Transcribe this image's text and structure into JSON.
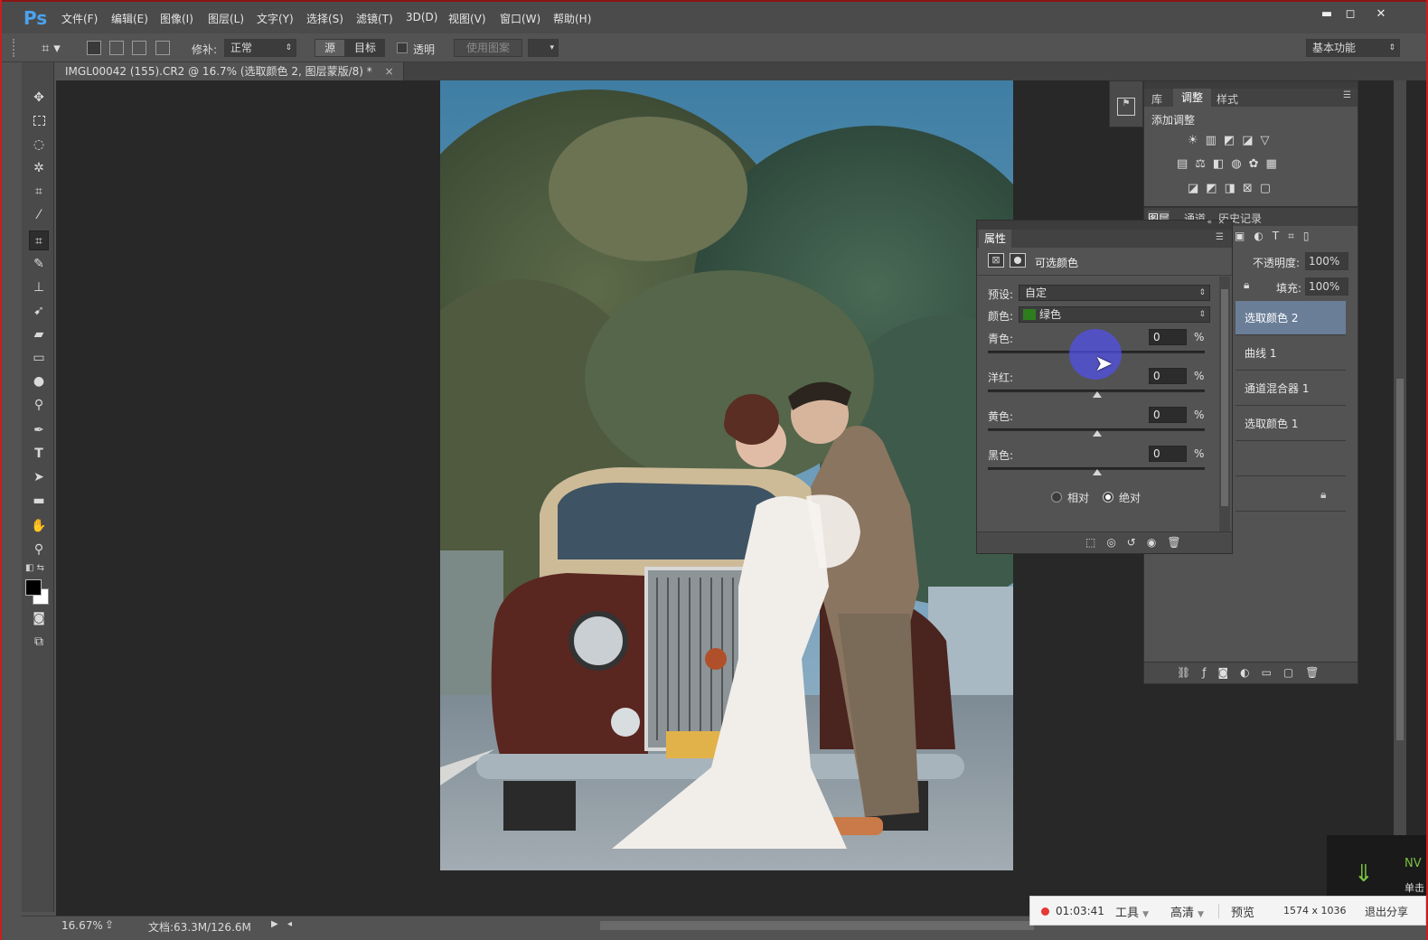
{
  "app": {
    "logo": "Ps"
  },
  "menu": [
    "文件(F)",
    "编辑(E)",
    "图像(I)",
    "图层(L)",
    "文字(Y)",
    "选择(S)",
    "滤镜(T)",
    "3D(D)",
    "视图(V)",
    "窗口(W)",
    "帮助(H)"
  ],
  "window_controls": {
    "minimize": "▬",
    "restore": "◻",
    "close": "✕"
  },
  "options": {
    "patch_label": "修补:",
    "patch_value": "正常",
    "source": "源",
    "target": "目标",
    "transparent": "透明",
    "use_pattern": "使用图案",
    "workspace": "基本功能"
  },
  "document_tab": {
    "title": "IMGL00042 (155).CR2 @ 16.7% (选取颜色 2, 图层蒙版/8) *",
    "close": "×"
  },
  "status": {
    "zoom": "16.67%",
    "doc_info": "文档:63.3M/126.6M"
  },
  "adjust_panel": {
    "tabs": [
      "库",
      "调整",
      "样式"
    ],
    "active_tab": "调整",
    "heading": "添加调整"
  },
  "layers_panel": {
    "tabs": [
      "图层",
      "通道",
      "历史记录"
    ],
    "opacity_label": "不透明度:",
    "opacity_value": "100%",
    "fill_label": "填充:",
    "fill_value": "100%",
    "layers": [
      "选取颜色 2",
      "曲线 1",
      "通道混合器 1",
      "选取颜色 1"
    ],
    "selected_layer": "选取颜色 2"
  },
  "properties": {
    "tab": "属性",
    "title": "可选颜色",
    "preset_label": "预设:",
    "preset_value": "自定",
    "colors_label": "颜色:",
    "colors_value": "绿色",
    "colors_swatch": "#2e7d1e",
    "sliders": [
      {
        "label": "青色:",
        "value": "0",
        "unit": "%"
      },
      {
        "label": "洋红:",
        "value": "0",
        "unit": "%"
      },
      {
        "label": "黄色:",
        "value": "0",
        "unit": "%"
      },
      {
        "label": "黑色:",
        "value": "0",
        "unit": "%"
      }
    ],
    "method_relative": "相对",
    "method_absolute": "绝对",
    "method_selected": "绝对"
  },
  "recorder": {
    "time": "01:03:41",
    "tools": "工具",
    "quality": "高清",
    "preview": "预览",
    "resolution": "1574 x 1036",
    "exit_share": "退出分享",
    "nv_text": "NV",
    "side_text": "单击"
  },
  "colors": {
    "accent_blue": "#4aa3ee",
    "selected_layer": "#6b7e98",
    "recording_dot": "#e53935"
  }
}
